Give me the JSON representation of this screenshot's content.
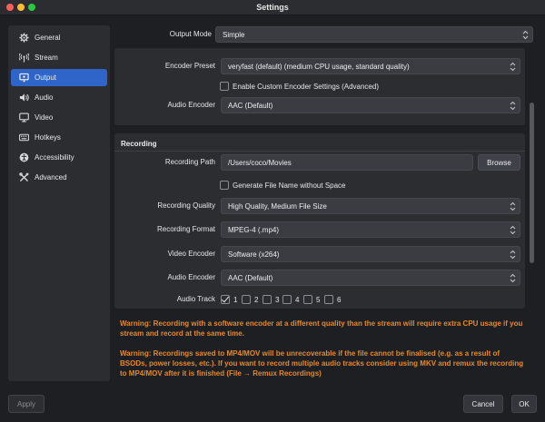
{
  "window": {
    "title": "Settings"
  },
  "sidebar": {
    "items": [
      {
        "label": "General",
        "icon": "gear-icon"
      },
      {
        "label": "Stream",
        "icon": "antenna-icon"
      },
      {
        "label": "Output",
        "icon": "output-icon",
        "active": true
      },
      {
        "label": "Audio",
        "icon": "speaker-icon"
      },
      {
        "label": "Video",
        "icon": "monitor-icon"
      },
      {
        "label": "Hotkeys",
        "icon": "keyboard-icon"
      },
      {
        "label": "Accessibility",
        "icon": "accessibility-icon"
      },
      {
        "label": "Advanced",
        "icon": "tools-icon"
      }
    ]
  },
  "output_mode": {
    "label": "Output Mode",
    "value": "Simple"
  },
  "streaming": {
    "encoder_preset": {
      "label": "Encoder Preset",
      "value": "veryfast (default) (medium CPU usage, standard quality)"
    },
    "custom_encoder": {
      "label": "Enable Custom Encoder Settings (Advanced)",
      "checked": false
    },
    "audio_encoder": {
      "label": "Audio Encoder",
      "value": "AAC (Default)"
    }
  },
  "recording": {
    "title": "Recording",
    "path": {
      "label": "Recording Path",
      "value": "/Users/coco/Movies",
      "browse_label": "Browse"
    },
    "no_space": {
      "label": "Generate File Name without Space",
      "checked": false
    },
    "quality": {
      "label": "Recording Quality",
      "value": "High Quality, Medium File Size"
    },
    "format": {
      "label": "Recording Format",
      "value": "MPEG-4 (.mp4)"
    },
    "video_encoder": {
      "label": "Video Encoder",
      "value": "Software (x264)"
    },
    "audio_encoder": {
      "label": "Audio Encoder",
      "value": "AAC (Default)"
    },
    "audio_track": {
      "label": "Audio Track",
      "tracks": [
        {
          "label": "1",
          "checked": true
        },
        {
          "label": "2",
          "checked": false
        },
        {
          "label": "3",
          "checked": false
        },
        {
          "label": "4",
          "checked": false
        },
        {
          "label": "5",
          "checked": false
        },
        {
          "label": "6",
          "checked": false
        }
      ]
    }
  },
  "warnings": {
    "software_encoder": "Warning: Recording with a software encoder at a different quality than the stream will require extra CPU usage if you stream and record at the same time.",
    "mp4": "Warning: Recordings saved to MP4/MOV will be unrecoverable if the file cannot be finalised (e.g. as a result of BSODs, power losses, etc.). If you want to record multiple audio tracks consider using MKV and remux the recording to MP4/MOV after it is finished (File → Remux Recordings)"
  },
  "footer": {
    "apply_label": "Apply",
    "cancel_label": "Cancel",
    "ok_label": "OK"
  },
  "colors": {
    "accent": "#2f64c8",
    "warning": "#e58a22"
  }
}
